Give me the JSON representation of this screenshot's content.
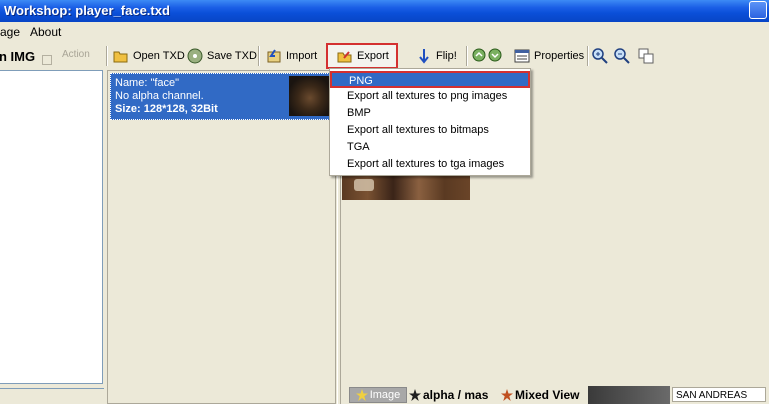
{
  "window": {
    "title": "Workshop: player_face.txd"
  },
  "menu": {
    "items": [
      "age",
      "About"
    ]
  },
  "left_panel": {
    "title": "n IMG",
    "action_label": "Action"
  },
  "toolbar": {
    "open_txd": "Open TXD",
    "save_txd": "Save TXD",
    "import": "Import",
    "export": "Export",
    "flip": "Flip!",
    "properties": "Properties"
  },
  "texture_item": {
    "name": "Name: \"face\"",
    "alpha": "No alpha channel.",
    "size": "Size: 128*128, 32Bit"
  },
  "export_menu": {
    "items": [
      "PNG",
      "Export all textures to png images",
      "BMP",
      "Export all textures to bitmaps",
      "TGA",
      "Export all textures to tga images"
    ],
    "selected_index": 0
  },
  "bottom_tabs": {
    "image": "Image",
    "alpha_mask": "alpha / mas",
    "mixed_view": "Mixed View"
  },
  "status": {
    "game": "SAN ANDREAS"
  },
  "colors": {
    "selection": "#316ac5",
    "highlight_border": "#d43030",
    "titlebar": "#0a4fd8",
    "face": "#ece9d8"
  }
}
